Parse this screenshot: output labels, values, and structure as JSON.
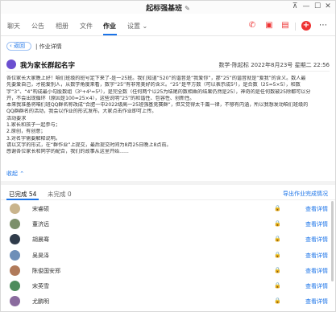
{
  "window": {
    "title": "起标强基班"
  },
  "tabs": [
    {
      "label": "聊天"
    },
    {
      "label": "公告"
    },
    {
      "label": "相册"
    },
    {
      "label": "文件"
    },
    {
      "label": "作业"
    },
    {
      "label": "设置"
    }
  ],
  "settings_suffix": "⌄",
  "breadcrumb": {
    "back_label": "返回",
    "current": "作业详情"
  },
  "detail": {
    "title": "我为家长群起名字",
    "meta": "数学-陈起标 2022年8月23号 星期二 22:56"
  },
  "content_lines": [
    "各位家长大家晚上好！咱们班级的班号定下来了-是一25班。我们知道“520”的谐音是“我爱你”，那“25”的谐音就是“爱我”的含义。数人最",
    "先要爱自己，才能爱别人，从数学角度来看，数字“25”有非常美好的含义。“25”是平方数（可以表示成5²），是合数（25=5×5），和数",
    "字“3”、“4”构成最小勾股数组（3²+4²=5²），是完全数（任何两个以25为结尾的数相乘的结果仍然是25），神奇的是任何数被25除都可以分",
    "开，不会出现循环（原因是100=25×4），这些说明“25”的和谐性、包容性、创新性。",
    "本来我准备将咱们班QQ群名称改成“合肥一中2022级高一25班强基竞赛群”，但又觉得太千篇一律，不够有内涵，所以我想发动咱们班级的",
    "QQ群群名的活动，我会以作业的形式发布，大家点击作业即可上传。",
    "活动要求",
    "1.家长和孩子一起参与；",
    "2.原创，有创意；",
    "3.对名字需要解释说明。",
    "请以文字的形式，在“群作业”上提交，最后提交时间为8月25日晚上8点前。",
    "感谢各位家长和同学的配合，我们的故事从这里开始......"
  ],
  "collapse_label": "收起 ⌃",
  "completion": {
    "done_label": "已完成",
    "done_count": "54",
    "pending_label": "未完成",
    "pending_count": "0",
    "export_label": "导出作业完成情况"
  },
  "students": [
    {
      "name": "宋睿硕",
      "action": "查看详情",
      "avatar_color": "#c9b48c"
    },
    {
      "name": "董济远",
      "action": "查看详情",
      "avatar_color": "#7b8f6a"
    },
    {
      "name": "胡晨骞",
      "action": "查看详情",
      "avatar_color": "#2f3b4a"
    },
    {
      "name": "吴昊泽",
      "action": "查看详情",
      "avatar_color": "#6e8fb8"
    },
    {
      "name": "陈俊国安郑",
      "action": "查看详情",
      "avatar_color": "#b07a5a"
    },
    {
      "name": "宋英雪",
      "action": "查看详情",
      "avatar_color": "#4d8c5c"
    },
    {
      "name": "尤鹏明",
      "action": "查看详情",
      "avatar_color": "#8a6b9e"
    }
  ],
  "colors": {
    "accent": "#1a73e8",
    "header_icon": "#6b4fd0",
    "add_button": "#e33333"
  },
  "icons": {
    "phone": "phone-icon",
    "video": "video-icon",
    "screen_share": "screen-share-icon",
    "add": "add-icon",
    "more": "more-icon",
    "lock": "lock-icon"
  }
}
